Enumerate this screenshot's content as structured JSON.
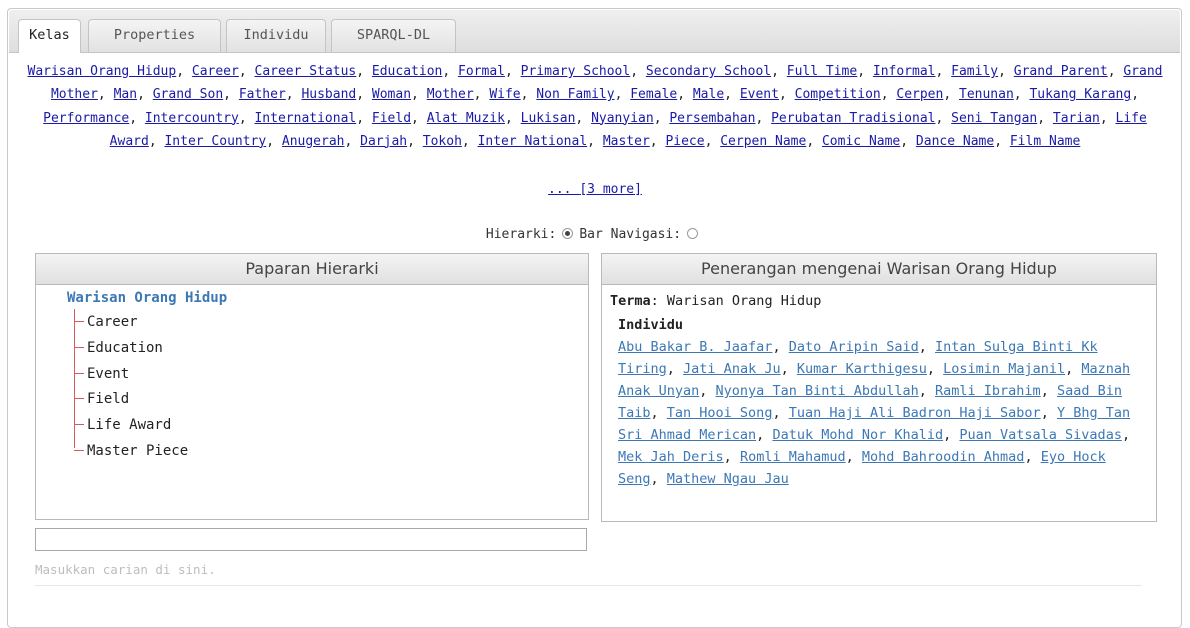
{
  "tabs": [
    "Kelas",
    "Properties",
    "Individu",
    "SPARQL-DL"
  ],
  "classes": [
    "Warisan Orang Hidup",
    "Career",
    "Career Status",
    "Education",
    "Formal",
    "Primary School",
    "Secondary School",
    "Full Time",
    "Informal",
    "Family",
    "Grand Parent",
    "Grand Mother",
    "Man",
    "Grand Son",
    "Father",
    "Husband",
    "Woman",
    "Mother",
    "Wife",
    "Non Family",
    "Female",
    "Male",
    "Event",
    "Competition",
    "Cerpen",
    "Tenunan",
    "Tukang Karang",
    "Performance",
    "Intercountry",
    "International",
    "Field",
    "Alat Muzik",
    "Lukisan",
    "Nyanyian",
    "Persembahan",
    "Perubatan Tradisional",
    "Seni Tangan",
    "Tarian",
    "Life Award",
    "Inter Country",
    "Anugerah",
    "Darjah",
    "Tokoh",
    "Inter National",
    "Master",
    "Piece",
    "Cerpen Name",
    "Comic Name",
    "Dance Name",
    "Film Name"
  ],
  "more_link": "... [3 more]",
  "mode": {
    "hierarchy_label": "Hierarki:",
    "navbar_label": "Bar Navigasi:",
    "selected": "Hierarki"
  },
  "hierarchy_panel": {
    "title": "Paparan Hierarki",
    "root": "Warisan Orang Hidup",
    "children": [
      "Career",
      "Education",
      "Event",
      "Field",
      "Life Award",
      "Master Piece"
    ]
  },
  "description_panel": {
    "title": "Penerangan mengenai Warisan Orang Hidup",
    "term_label": "Terma",
    "term_value": "Warisan Orang Hidup",
    "individuals_label": "Individu",
    "individuals": [
      "Abu Bakar B. Jaafar",
      "Dato Aripin Said",
      "Intan Sulga Binti Kk Tiring",
      "Jati Anak Ju",
      "Kumar Karthigesu",
      "Losimin Majanil",
      "Maznah Anak Unyan",
      "Nyonya Tan Binti Abdullah",
      "Ramli Ibrahim",
      "Saad Bin Taib",
      "Tan Hooi Song",
      "Tuan Haji Ali Badron Haji Sabor",
      "Y Bhg Tan Sri Ahmad Merican",
      "Datuk Mohd Nor Khalid",
      "Puan Vatsala Sivadas",
      "Mek Jah Deris",
      "Romli Mahamud",
      "Mohd Bahroodin Ahmad",
      "Eyo Hock Seng",
      "Mathew Ngau Jau"
    ]
  },
  "search": {
    "value": "",
    "hint": "Masukkan carian di sini."
  }
}
